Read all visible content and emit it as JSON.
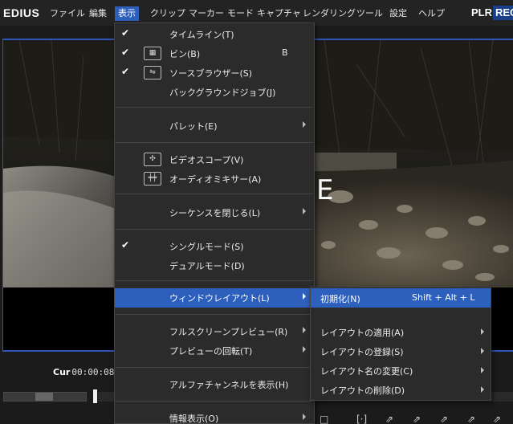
{
  "app": {
    "logo": "EDIUS"
  },
  "menubar": {
    "items": [
      {
        "label": "ファイル",
        "active": false
      },
      {
        "label": "編集",
        "active": false
      },
      {
        "label": "表示",
        "active": true
      },
      {
        "label": "クリップ",
        "active": false
      },
      {
        "label": "マーカー",
        "active": false
      },
      {
        "label": "モード",
        "active": false
      },
      {
        "label": "キャプチャ",
        "active": false
      },
      {
        "label": "レンダリング",
        "active": false
      },
      {
        "label": "ツール",
        "active": false
      },
      {
        "label": "設定",
        "active": false
      },
      {
        "label": "ヘルプ",
        "active": false
      }
    ],
    "plr": "PLR",
    "rec": "REC"
  },
  "preview": {
    "overlay_letter": "E"
  },
  "transport": {
    "timecode_prefix": "Cur",
    "timecode": "00:00:08"
  },
  "view_menu": {
    "items": [
      {
        "label": "タイムライン(T)",
        "checked": true
      },
      {
        "label": "ビン(B)",
        "checked": true,
        "icon": "bin-grid-icon",
        "shortcut": "B"
      },
      {
        "label": "ソースブラウザー(S)",
        "checked": true,
        "icon": "usb-icon"
      },
      {
        "label": "バックグラウンドジョブ(J)"
      },
      {
        "label": "パレット(E)",
        "submenu": true
      },
      {
        "label": "ビデオスコープ(V)",
        "icon": "scope-icon"
      },
      {
        "label": "オーディオミキサー(A)",
        "icon": "mixer-icon"
      },
      {
        "label": "シーケンスを閉じる(L)",
        "submenu": true
      },
      {
        "label": "シングルモード(S)",
        "checked": true
      },
      {
        "label": "デュアルモード(D)"
      },
      {
        "label": "ウィンドウレイアウト(L)",
        "submenu": true,
        "highlighted": true
      },
      {
        "label": "フルスクリーンプレビュー(R)",
        "submenu": true
      },
      {
        "label": "プレビューの回転(T)",
        "submenu": true
      },
      {
        "label": "アルファチャンネルを表示(H)"
      },
      {
        "label": "情報表示(O)",
        "submenu": true
      }
    ]
  },
  "layout_submenu": {
    "items": [
      {
        "label": "初期化(N)",
        "shortcut": "Shift + Alt + L",
        "highlighted": true
      },
      {
        "label": "レイアウトの適用(A)",
        "submenu": true
      },
      {
        "label": "レイアウトの登録(S)",
        "submenu": true
      },
      {
        "label": "レイアウト名の変更(C)",
        "submenu": true
      },
      {
        "label": "レイアウトの削除(D)",
        "submenu": true
      }
    ]
  },
  "colors": {
    "accent": "#2d5fbd",
    "menu_bg": "#2b2b2b",
    "frame_border": "#2f55b8"
  }
}
